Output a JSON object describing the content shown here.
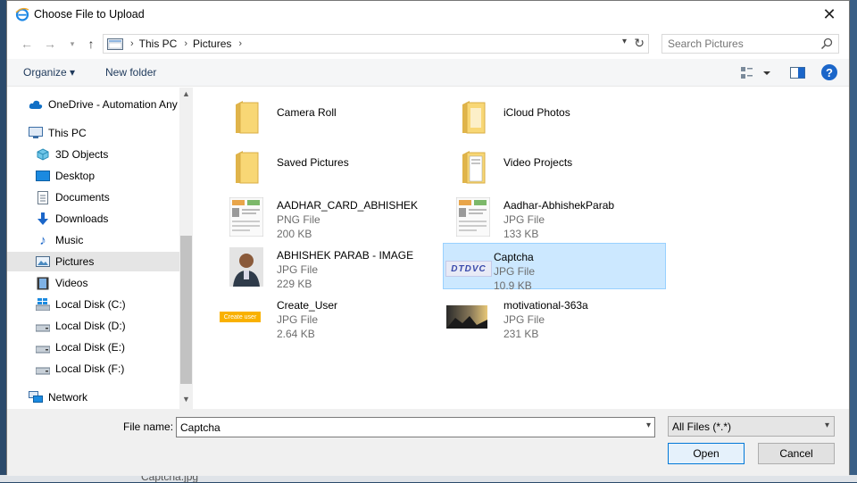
{
  "window": {
    "title": "Choose File to Upload"
  },
  "address": {
    "crumbs": [
      "This PC",
      "Pictures"
    ]
  },
  "search": {
    "placeholder": "Search Pictures"
  },
  "toolbar": {
    "organize": "Organize ▾",
    "new_folder": "New folder"
  },
  "nav": {
    "onedrive": "OneDrive - Automation Any",
    "this_pc": "This PC",
    "objects3d": "3D Objects",
    "desktop": "Desktop",
    "documents": "Documents",
    "downloads": "Downloads",
    "music": "Music",
    "pictures": "Pictures",
    "videos": "Videos",
    "disk_c": "Local Disk (C:)",
    "disk_d": "Local Disk (D:)",
    "disk_e": "Local Disk (E:)",
    "disk_f": "Local Disk (F:)",
    "network": "Network"
  },
  "files": {
    "camera_roll": {
      "name": "Camera Roll"
    },
    "icloud": {
      "name": "iCloud Photos"
    },
    "saved_pictures": {
      "name": "Saved Pictures"
    },
    "video_projects": {
      "name": "Video Projects"
    },
    "aadhar_card": {
      "name": "AADHAR_CARD_ABHISHEK",
      "type": "PNG File",
      "size": "200 KB"
    },
    "aadhar_parab": {
      "name": "Aadhar-AbhishekParab",
      "type": "JPG File",
      "size": "133 KB"
    },
    "abhishek_image": {
      "name": "ABHISHEK PARAB - IMAGE",
      "type": "JPG File",
      "size": "229 KB"
    },
    "captcha": {
      "name": "Captcha",
      "type": "JPG File",
      "size": "10.9 KB",
      "thumb_text": "DTDVC"
    },
    "create_user": {
      "name": "Create_User",
      "type": "JPG File",
      "size": "2.64 KB",
      "thumb_text": "Create user"
    },
    "motivational": {
      "name": "motivational-363a",
      "type": "JPG File",
      "size": "231 KB"
    }
  },
  "bottom": {
    "file_name_label": "File name:",
    "file_name_value": "Captcha",
    "filter": "All Files (*.*)",
    "open": "Open",
    "cancel": "Cancel"
  },
  "background": {
    "partial_text": "Captcha.jpg"
  },
  "colors": {
    "accent": "#0078d7",
    "selection": "#cce8ff",
    "folder": "#f8d775"
  }
}
